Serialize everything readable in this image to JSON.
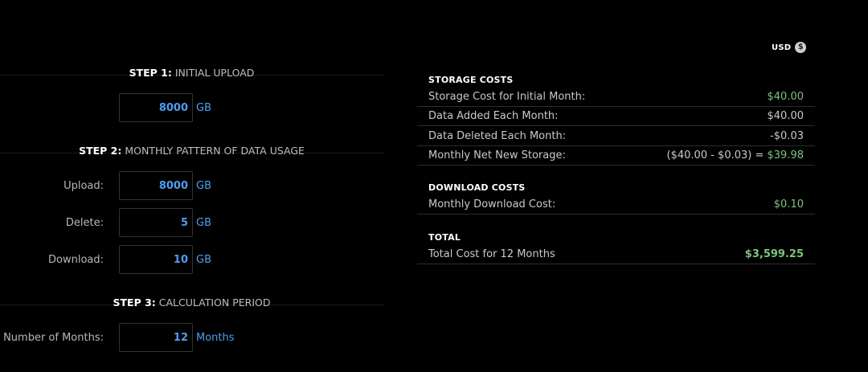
{
  "currency": {
    "label": "USD",
    "icon": "dollar-icon",
    "icon_glyph": "$"
  },
  "steps": {
    "step1": {
      "number": "STEP 1:",
      "title": "INITIAL UPLOAD",
      "upload_value": "8000",
      "upload_unit": "GB"
    },
    "step2": {
      "number": "STEP 2:",
      "title": "MONTHLY PATTERN OF DATA USAGE",
      "fields": [
        {
          "label": "Upload:",
          "value": "8000",
          "unit": "GB"
        },
        {
          "label": "Delete:",
          "value": "5",
          "unit": "GB"
        },
        {
          "label": "Download:",
          "value": "10",
          "unit": "GB"
        }
      ]
    },
    "step3": {
      "number": "STEP 3:",
      "title": "CALCULATION PERIOD",
      "months_label": "Number of Months:",
      "months_value": "12",
      "months_unit": "Months"
    }
  },
  "storage_costs": {
    "title": "STORAGE COSTS",
    "rows": [
      {
        "label": "Storage Cost for Initial Month:",
        "value": "$40.00"
      },
      {
        "label": "Data Added Each Month:",
        "value": "$40.00"
      },
      {
        "label": "Data Deleted Each Month:",
        "value": "-$0.03"
      },
      {
        "label": "Monthly Net New Storage:",
        "value_prefix": "($40.00 - $0.03) =",
        "value": "$39.98"
      }
    ]
  },
  "download_costs": {
    "title": "DOWNLOAD COSTS",
    "rows": [
      {
        "label": "Monthly Download Cost:",
        "value": "$0.10"
      }
    ]
  },
  "total": {
    "title": "TOTAL",
    "rows": [
      {
        "label": "Total Cost for 12 Months",
        "value": "$3,599.25"
      }
    ]
  },
  "colors": {
    "accent_blue": "#4f9df0",
    "cost_green": "#7cc47c",
    "background": "#000000"
  }
}
